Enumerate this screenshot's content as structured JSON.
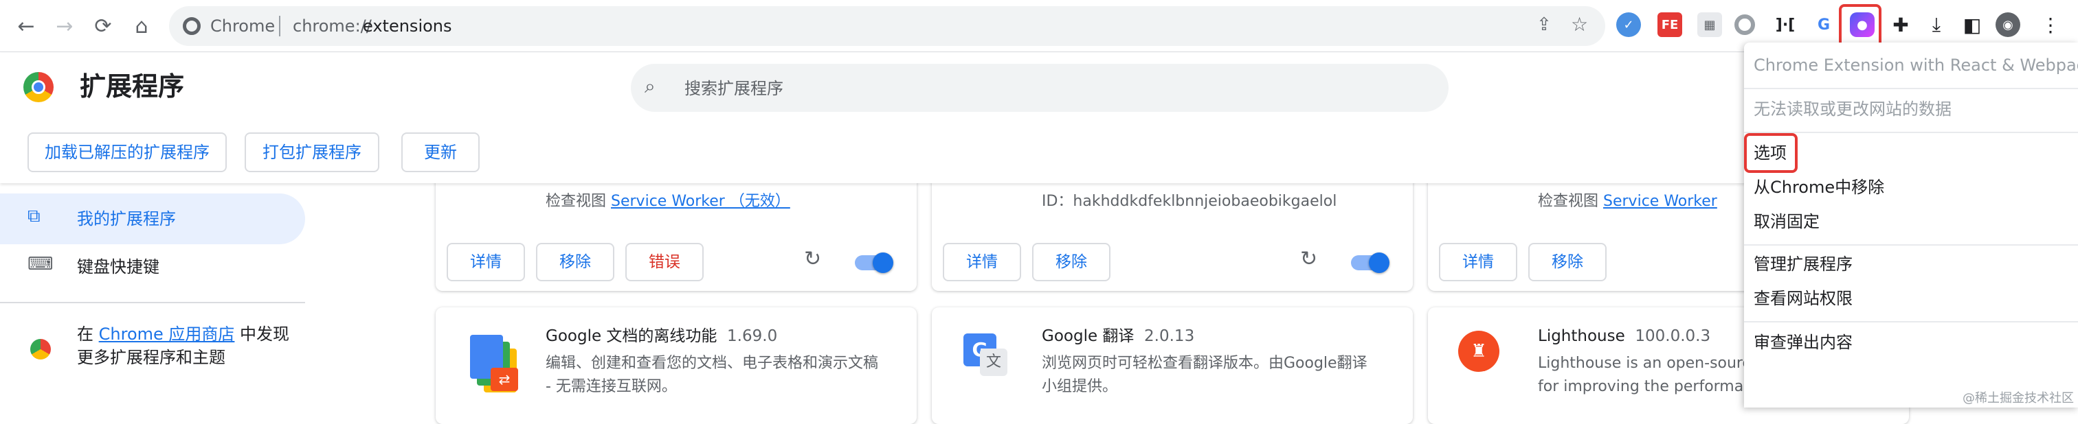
{
  "browser": {
    "omnibox_site": "Chrome",
    "omnibox_scheme": "chrome://",
    "omnibox_path": "extensions",
    "extension_icons": [
      {
        "name": "translate-ext-icon",
        "glyph": "",
        "color": "#4a90e2"
      },
      {
        "name": "fe-ext-icon",
        "glyph": "FE",
        "color": "#e53935"
      },
      {
        "name": "dashboard-ext-icon",
        "glyph": "",
        "color": "#9aa0a6"
      },
      {
        "name": "circle-ext-icon",
        "glyph": "",
        "color": "#9aa0a6"
      },
      {
        "name": "bracket-ext-icon",
        "glyph": "",
        "color": "#5f6368"
      },
      {
        "name": "translate-g-ext-icon",
        "glyph": "",
        "color": "#4285f4"
      },
      {
        "name": "react-webpack-ext-icon",
        "glyph": "",
        "color": "#a142f4"
      }
    ]
  },
  "header": {
    "title": "扩展程序",
    "search_placeholder": "搜索扩展程序",
    "buttons": [
      "加载已解压的扩展程序",
      "打包扩展程序",
      "更新"
    ]
  },
  "sidebar": {
    "items": [
      "我的扩展程序",
      "键盘快捷键"
    ],
    "store_prefix": "在 ",
    "store_link": "Chrome 应用商店",
    "store_suffix": " 中发现",
    "store_line2": "更多扩展程序和主题"
  },
  "cards_top": [
    {
      "inspect_label": "检查视图",
      "inspect_link": "Service Worker （无效）",
      "buttons": [
        "详情",
        "移除",
        "错误"
      ],
      "enabled": true
    },
    {
      "id_line": "ID：hakhddkdfeklbnnjeiobaeobikgaelol",
      "buttons": [
        "详情",
        "移除"
      ],
      "enabled": true
    },
    {
      "inspect_label": "检查视图",
      "inspect_link": "Service Worker",
      "buttons": [
        "详情",
        "移除"
      ]
    }
  ],
  "cards_bottom": [
    {
      "name": "Google 文档的离线功能",
      "version": "1.69.0",
      "desc": [
        "编辑、创建和查看您的文档、电子表格和演示文稿",
        "- 无需连接互联网。"
      ]
    },
    {
      "name": "Google 翻译",
      "version": "2.0.13",
      "desc": [
        "浏览网页时可轻松查看翻译版本。由Google翻译",
        "小组提供。"
      ]
    },
    {
      "name": "Lighthouse",
      "version": "100.0.0.3",
      "desc": [
        "Lighthouse is an open-source, automated tool",
        "for improving the performance, quality, and"
      ]
    }
  ],
  "menu": {
    "title": "Chrome Extension with React & Webpack",
    "note": "无法读取或更改网站的数据",
    "items_group1": [
      "选项",
      "从Chrome中移除",
      "取消固定"
    ],
    "items_group2": [
      "管理扩展程序",
      "查看网站权限"
    ],
    "items_group3": [
      "审查弹出内容"
    ]
  },
  "watermark": "@稀土掘金技术社区",
  "colors": {
    "accent": "#1a73e8",
    "error": "#d93025",
    "highlight": "#e53935"
  }
}
